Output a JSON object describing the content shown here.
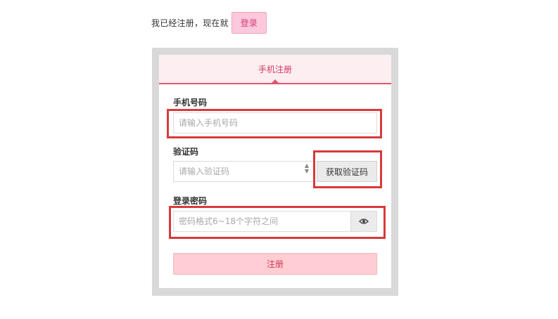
{
  "header": {
    "prompt_text": "我已经注册，现在就",
    "login_label": "登录"
  },
  "form": {
    "tab_label": "手机注册",
    "phone": {
      "label": "手机号码",
      "placeholder": "请输入手机号码"
    },
    "code": {
      "label": "验证码",
      "placeholder": "请输入验证码",
      "get_code_label": "获取验证码"
    },
    "password": {
      "label": "登录密码",
      "placeholder": "密码格式6~18个字符之间"
    },
    "submit_label": "注册"
  },
  "icons": {
    "password_toggle": "eye-icon",
    "stepper": "stepper-icon"
  },
  "colors": {
    "accent": "#e0566f",
    "tab_bg": "#fdeef2",
    "login_bg": "#fcc8dc",
    "submit_bg": "#ffcdd4",
    "annotation": "#d93a3a"
  }
}
